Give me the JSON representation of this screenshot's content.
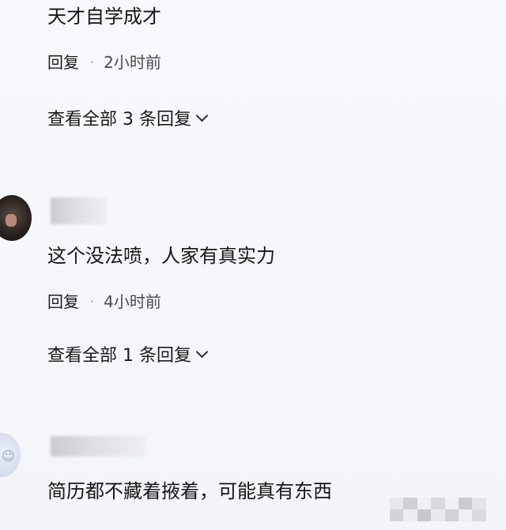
{
  "comments": [
    {
      "text": "天才自学成才",
      "reply_label": "回复",
      "separator": "·",
      "time": "2小时前",
      "view_all": "查看全部 3 条回复"
    },
    {
      "text": "这个没法喷，人家有真实力",
      "reply_label": "回复",
      "separator": "·",
      "time": "4小时前",
      "view_all": "查看全部 1 条回复"
    },
    {
      "text": "简历都不藏着掖着，可能真有东西"
    }
  ],
  "icons": {
    "expand": "chevron-down-icon"
  }
}
